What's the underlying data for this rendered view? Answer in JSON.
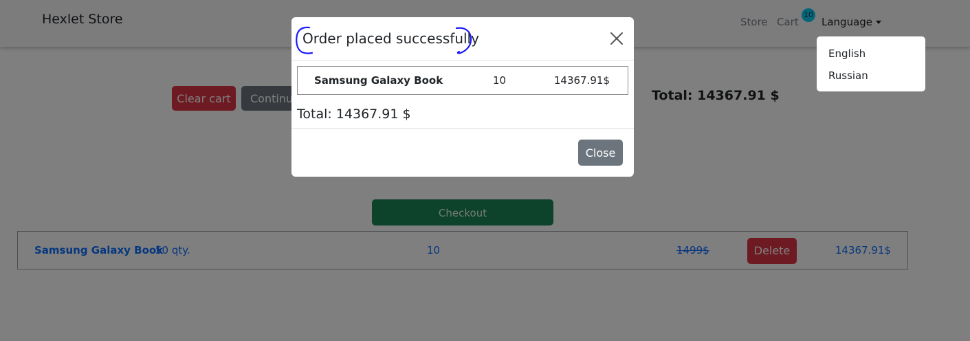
{
  "navbar": {
    "brand": "Hexlet Store",
    "store_link": "Store",
    "cart_link": "Cart",
    "cart_badge": "10",
    "language_label": "Language"
  },
  "language_menu": {
    "options": [
      "English",
      "Russian"
    ]
  },
  "cart_page": {
    "clear_label": "Clear cart",
    "continue_label": "Continue",
    "total_label": "Total: 14367.91 $",
    "checkout_label": "Checkout",
    "rows": [
      {
        "name": "Samsung Galaxy Book",
        "stock": "50 qty.",
        "count": "10",
        "old_price": "1499$",
        "delete_label": "Delete",
        "sum": "14367.91$"
      }
    ]
  },
  "modal": {
    "title": "Order placed successfully",
    "items": [
      {
        "name": "Samsung Galaxy Book",
        "qty": "10",
        "sum": "14367.91$"
      }
    ],
    "total": "Total: 14367.91 $",
    "close_label": "Close"
  },
  "colors": {
    "danger": "#dc3545",
    "secondary": "#6c757d",
    "success": "#198754",
    "info": "#0dcaf0",
    "link": "#0d6efd",
    "annotation": "#1a1aff"
  }
}
